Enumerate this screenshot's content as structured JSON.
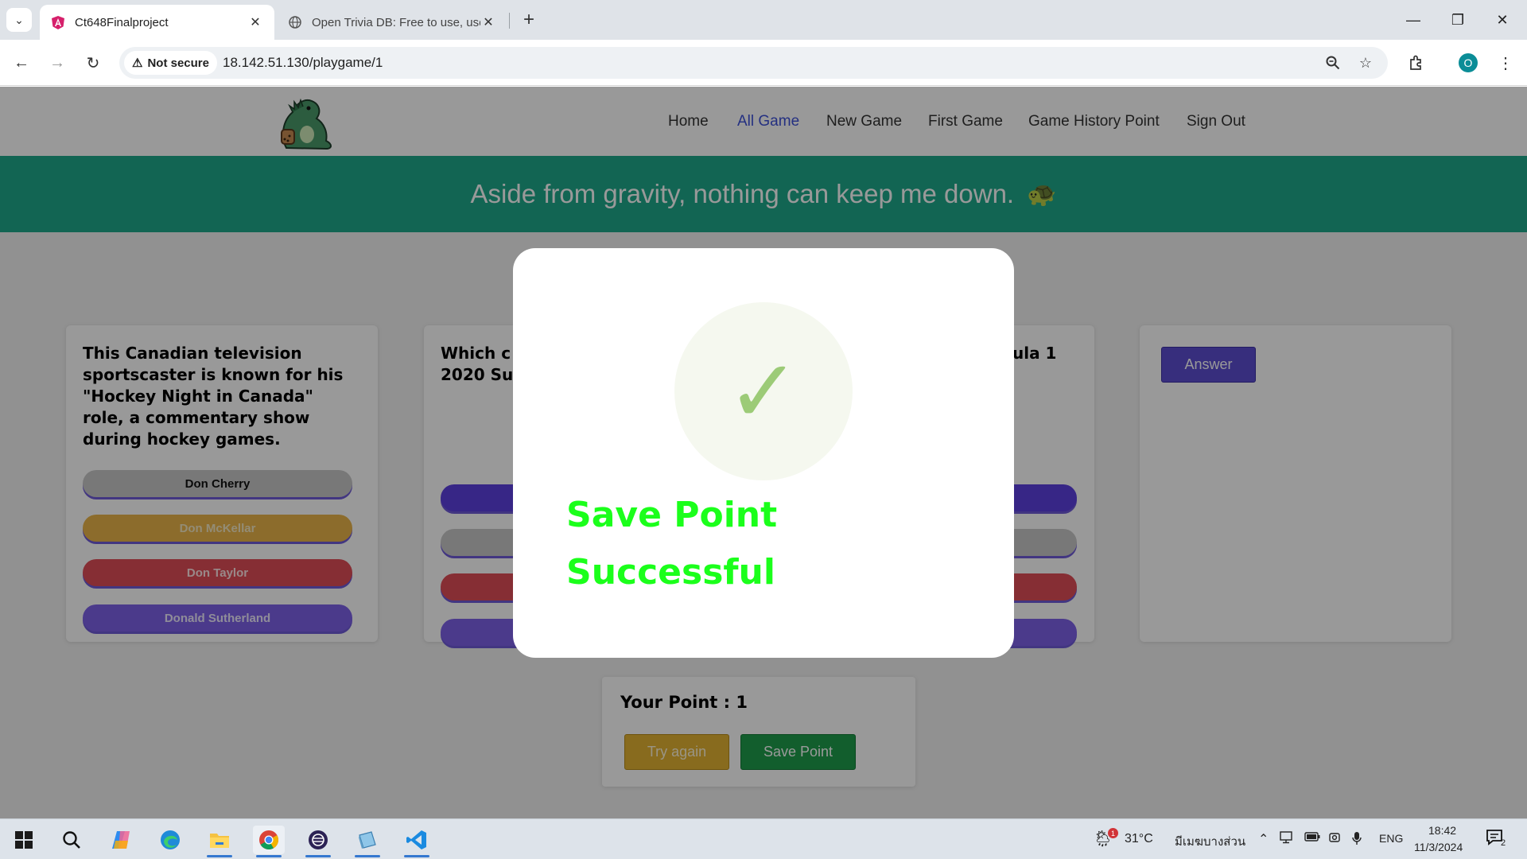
{
  "browser": {
    "tabs": [
      {
        "title": "Ct648Finalproject",
        "favicon": "angular-icon",
        "active": true
      },
      {
        "title": "Open Trivia DB: Free to use, use",
        "favicon": "globe-icon",
        "active": false
      }
    ],
    "security_label": "Not secure",
    "url": "18.142.51.130/playgame/1",
    "profile_initial": "O"
  },
  "site": {
    "nav": [
      "Home",
      "All Game",
      "New Game",
      "First Game",
      "Game History Point",
      "Sign Out"
    ],
    "active_nav": "All Game",
    "banner_text": "Aside from gravity, nothing can keep me down."
  },
  "cards": [
    {
      "question": "This Canadian television sportscaster is known for his \"Hockey Night in Canada\" role, a commentary show during hockey games.",
      "answers": [
        "Don Cherry",
        "Don McKellar",
        "Don Taylor",
        "Donald Sutherland"
      ]
    },
    {
      "question_visible_start": "Which c",
      "question_visible_line2": "2020 Su",
      "question_visible_tail": "ula 1"
    },
    {
      "answer_button": "Answer"
    }
  ],
  "score": {
    "label": "Your Point : 1",
    "try_again": "Try again",
    "save_point": "Save Point"
  },
  "modal": {
    "icon": "checkmark-icon",
    "message_line1": "Save Point",
    "message_line2": "Successful"
  },
  "taskbar": {
    "weather": "31°C",
    "location": "มีเมฆบางส่วน",
    "weather_badge": "1",
    "language": "ENG",
    "time": "18:42",
    "date": "11/3/2024",
    "notification_count": "2"
  },
  "colors": {
    "banner": "#1ea98b",
    "success_text": "#1bff1b",
    "answer_button": "#5d4ed0",
    "save_button": "#1f9d4c",
    "try_button": "#e3b233"
  }
}
